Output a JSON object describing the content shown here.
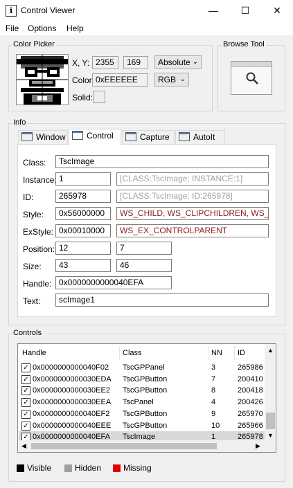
{
  "window": {
    "title": "Control Viewer",
    "icon_letter": "i",
    "minimize": "—",
    "maximize": "☐",
    "close": "✕"
  },
  "menu": [
    "File",
    "Options",
    "Help"
  ],
  "color_picker": {
    "label": "Color Picker",
    "xy_label": "X, Y:",
    "x": "2355",
    "y": "169",
    "mode": "Absolute",
    "color_label": "Color:",
    "color": "0xEEEEEE",
    "format": "RGB",
    "solid_label": "Solid:"
  },
  "browse_tool": {
    "label": "Browse Tool"
  },
  "info": {
    "label": "Info",
    "tabs": [
      "Window",
      "Control",
      "Capture",
      "AutoIt"
    ],
    "active_tab": "Control",
    "class_label": "Class:",
    "class": "TscImage",
    "instance_label": "Instance:",
    "instance": "1",
    "instance_ref": "[CLASS:TscImage; INSTANCE:1]",
    "id_label": "ID:",
    "id": "265978",
    "id_ref": "[CLASS:TscImage; ID:265978]",
    "style_label": "Style:",
    "style": "0x56000000",
    "style_flags": "WS_CHILD, WS_CLIPCHILDREN, WS_CLIPSIBLINGS",
    "exstyle_label": "ExStyle:",
    "exstyle": "0x00010000",
    "exstyle_flags": "WS_EX_CONTROLPARENT",
    "position_label": "Position:",
    "pos_x": "12",
    "pos_y": "7",
    "size_label": "Size:",
    "width": "43",
    "height": "46",
    "handle_label": "Handle:",
    "handle": "0x0000000000040EFA",
    "text_label": "Text:",
    "text": "scImage1"
  },
  "controls": {
    "label": "Controls",
    "columns": [
      "Handle",
      "Class",
      "NN",
      "ID"
    ],
    "rows": [
      {
        "handle": "0x0000000000040F02",
        "class": "TscGPPanel",
        "nn": "3",
        "id": "265986",
        "checked": true,
        "selected": false
      },
      {
        "handle": "0x0000000000030EDA",
        "class": "TscGPButton",
        "nn": "7",
        "id": "200410",
        "checked": true,
        "selected": false
      },
      {
        "handle": "0x0000000000030EE2",
        "class": "TscGPButton",
        "nn": "8",
        "id": "200418",
        "checked": true,
        "selected": false
      },
      {
        "handle": "0x0000000000030EEA",
        "class": "TscPanel",
        "nn": "4",
        "id": "200426",
        "checked": true,
        "selected": false
      },
      {
        "handle": "0x0000000000040EF2",
        "class": "TscGPButton",
        "nn": "9",
        "id": "265970",
        "checked": true,
        "selected": false
      },
      {
        "handle": "0x0000000000040EEE",
        "class": "TscGPButton",
        "nn": "10",
        "id": "265966",
        "checked": true,
        "selected": false
      },
      {
        "handle": "0x0000000000040EFA",
        "class": "TscImage",
        "nn": "1",
        "id": "265978",
        "checked": true,
        "selected": true
      }
    ],
    "check_glyph": "✓"
  },
  "legend": [
    {
      "label": "Visible",
      "color": "#000000"
    },
    {
      "label": "Hidden",
      "color": "#a0a0a0"
    },
    {
      "label": "Missing",
      "color": "#e00000"
    }
  ]
}
